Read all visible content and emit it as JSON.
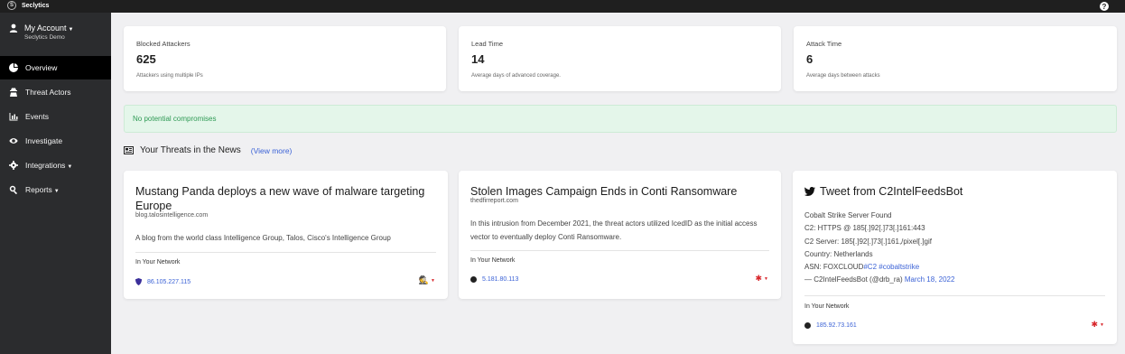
{
  "brand": {
    "name": "Seclytics"
  },
  "account": {
    "label": "My Account",
    "org": "Seclytics Demo"
  },
  "nav": [
    {
      "label": "Overview",
      "icon": "pie-chart-icon",
      "active": true
    },
    {
      "label": "Threat Actors",
      "icon": "user-secret-icon"
    },
    {
      "label": "Events",
      "icon": "bar-chart-icon"
    },
    {
      "label": "Investigate",
      "icon": "eye-icon"
    },
    {
      "label": "Integrations",
      "icon": "cog-icon",
      "dropdown": true
    },
    {
      "label": "Reports",
      "icon": "search-icon",
      "dropdown": true
    }
  ],
  "stats": [
    {
      "label": "Blocked Attackers",
      "value": "625",
      "desc": "Attackers using multiple IPs"
    },
    {
      "label": "Lead Time",
      "value": "14",
      "desc": "Average days of advanced coverage."
    },
    {
      "label": "Attack Time",
      "value": "6",
      "desc": "Average days between attacks"
    }
  ],
  "alert": {
    "text": "No potential compromises"
  },
  "news": {
    "heading": "Your Threats in the News",
    "view_more": "(View more)",
    "cards": [
      {
        "title": "Mustang Panda deploys a new wave of malware targeting Europe",
        "source": "blog.talosintelligence.com",
        "body": "A blog from the world class Intelligence Group, Talos, Cisco's Intelligence Group",
        "network_label": "In Your Network",
        "ip": "86.105.227.115"
      },
      {
        "title": "Stolen Images Campaign Ends in Conti Ransomware",
        "source": "thedfirreport.com",
        "body": "In this intrusion from December 2021, the threat actors utilized IcedID as the initial access vector to eventually deploy Conti Ransomware.",
        "network_label": "In Your Network",
        "ip": "5.181.80.113"
      },
      {
        "title": "Tweet from C2IntelFeedsBot",
        "lines": [
          "Cobalt Strike Server Found",
          "C2: HTTPS @ 185[.]92[.]73[.]161:443",
          "C2 Server: 185[.]92[.]73[.]161,/pixel[.]gif",
          "Country: Netherlands"
        ],
        "asn_prefix": "ASN: FOXCLOUD",
        "asn_tags": "#C2 #cobaltstrike",
        "byline": "— C2IntelFeedsBot (@drb_ra) ",
        "date": "March 18, 2022",
        "network_label": "In Your Network",
        "ip": "185.92.73.161"
      }
    ]
  },
  "colors": {
    "accent": "#3b62d6",
    "danger": "#d8262b",
    "success": "#2f9a55",
    "sidebar": "#2b2c2e"
  }
}
